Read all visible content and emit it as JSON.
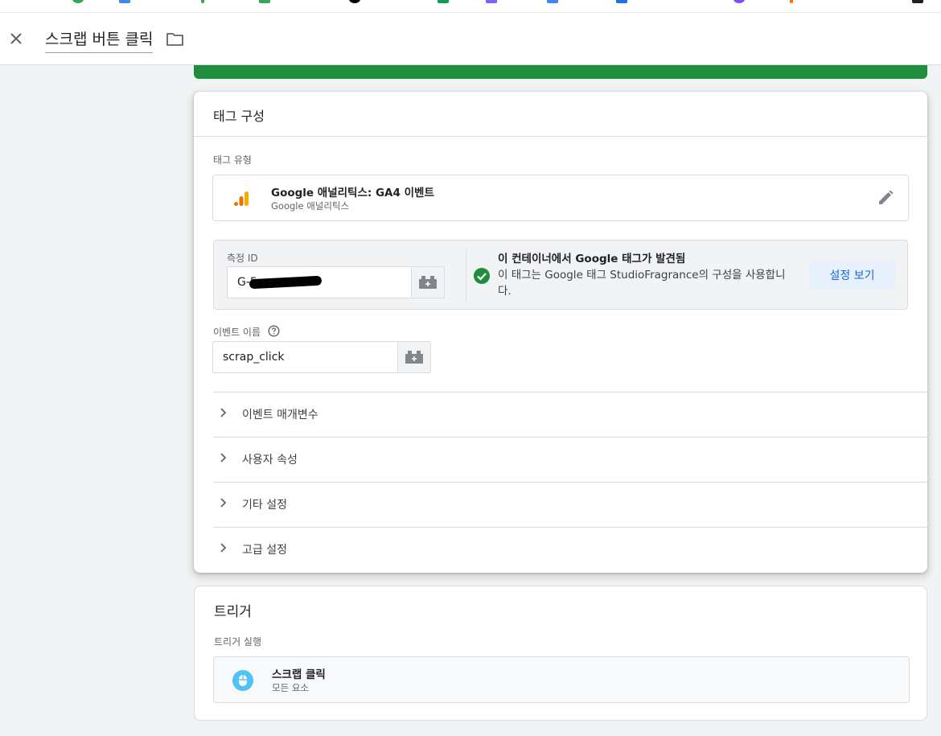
{
  "header": {
    "title": "스크랩 버튼 클릭"
  },
  "tag_config": {
    "title": "태그 구성",
    "tag_type_label": "태그 유형",
    "tag_type": {
      "name": "Google 애널리틱스: GA4 이벤트",
      "subtitle": "Google 애널리틱스"
    },
    "measurement_id_label": "측정 ID",
    "measurement_id_value": "G-5",
    "found": {
      "title": "이 컨테이너에서 Google 태그가 발견됨",
      "description": "이 태그는 Google 태그 StudioFragrance의 구성을 사용합니다.",
      "button": "설정 보기"
    },
    "event_name_label": "이벤트 이름",
    "event_name_value": "scrap_click",
    "sections": [
      {
        "label": "이벤트 매개변수"
      },
      {
        "label": "사용자 속성"
      },
      {
        "label": "기타 설정"
      },
      {
        "label": "고급 설정"
      }
    ]
  },
  "trigger": {
    "title": "트리거",
    "firing_label": "트리거 실행",
    "item": {
      "name": "스크랩 클릭",
      "subtitle": "모든 요소"
    }
  },
  "colors": {
    "green_bar": "#1e8e3e",
    "analytics_orange": "#f9ab00",
    "analytics_dark_orange": "#e37400",
    "check_green": "#1e8e3e",
    "trigger_blue": "#4fc3f7",
    "button_blue": "#1967d2"
  }
}
